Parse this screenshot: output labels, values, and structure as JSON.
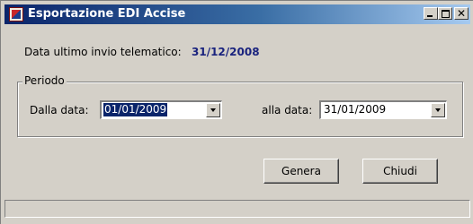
{
  "window": {
    "title": "Esportazione EDI Accise"
  },
  "info": {
    "last_send_label": "Data ultimo invio telematico:",
    "last_send_value": "31/12/2008"
  },
  "period": {
    "caption": "Periodo",
    "from_label": "Dalla data:",
    "from_value": "01/01/2009",
    "to_label": "alla data:",
    "to_value": "31/01/2009"
  },
  "buttons": {
    "generate": "Genera",
    "close": "Chiudi"
  },
  "status": {
    "text": ""
  },
  "icons": {
    "app": "app-icon",
    "minimize": "minimize-icon",
    "maximize": "maximize-icon",
    "close": "close-icon",
    "dropdown": "chevron-down-icon"
  }
}
